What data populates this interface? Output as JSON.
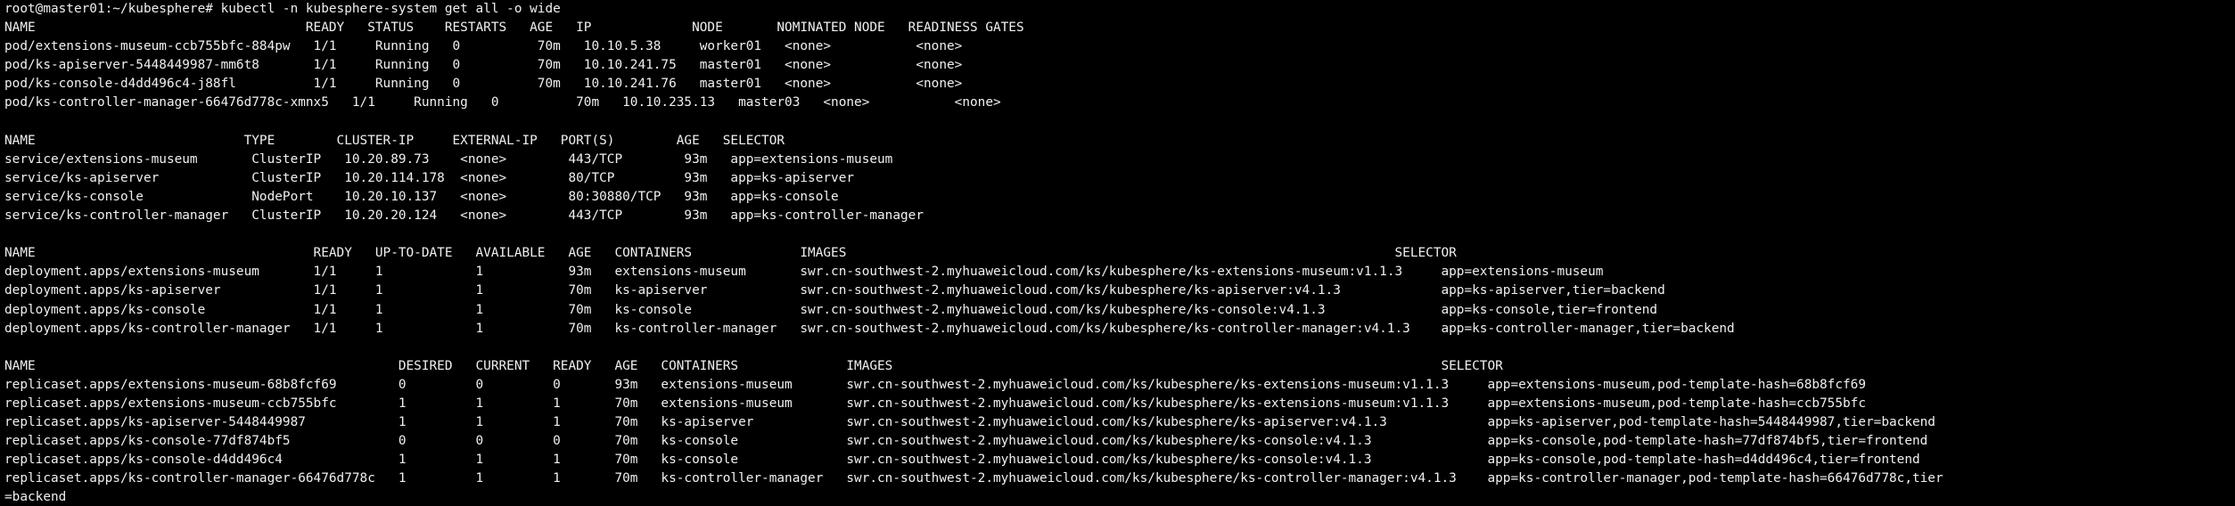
{
  "terminal": {
    "background": "#000000",
    "foreground": "#f0f0f0",
    "lines": [
      "root@master01:~/kubesphere# kubectl -n kubesphere-system get all -o wide",
      "NAME                                   READY   STATUS    RESTARTS   AGE   IP             NODE       NOMINATED NODE   READINESS GATES",
      "pod/extensions-museum-ccb755bfc-884pw   1/1     Running   0          70m   10.10.5.38     worker01   <none>           <none>",
      "pod/ks-apiserver-5448449987-mm6t8       1/1     Running   0          70m   10.10.241.75   master01   <none>           <none>",
      "pod/ks-console-d4dd496c4-j88fl          1/1     Running   0          70m   10.10.241.76   master01   <none>           <none>",
      "pod/ks-controller-manager-66476d778c-xmnx5   1/1     Running   0          70m   10.10.235.13   master03   <none>           <none>",
      "",
      "NAME                           TYPE        CLUSTER-IP     EXTERNAL-IP   PORT(S)        AGE   SELECTOR",
      "service/extensions-museum       ClusterIP   10.20.89.73    <none>        443/TCP        93m   app=extensions-museum",
      "service/ks-apiserver            ClusterIP   10.20.114.178  <none>        80/TCP         93m   app=ks-apiserver",
      "service/ks-console              NodePort    10.20.10.137   <none>        80:30880/TCP   93m   app=ks-console",
      "service/ks-controller-manager   ClusterIP   10.20.20.124   <none>        443/TCP        93m   app=ks-controller-manager",
      "",
      "NAME                                    READY   UP-TO-DATE   AVAILABLE   AGE   CONTAINERS              IMAGES                                                                       SELECTOR",
      "deployment.apps/extensions-museum       1/1     1            1           93m   extensions-museum       swr.cn-southwest-2.myhuaweicloud.com/ks/kubesphere/ks-extensions-museum:v1.1.3     app=extensions-museum",
      "deployment.apps/ks-apiserver            1/1     1            1           70m   ks-apiserver            swr.cn-southwest-2.myhuaweicloud.com/ks/kubesphere/ks-apiserver:v4.1.3             app=ks-apiserver,tier=backend",
      "deployment.apps/ks-console              1/1     1            1           70m   ks-console              swr.cn-southwest-2.myhuaweicloud.com/ks/kubesphere/ks-console:v4.1.3               app=ks-console,tier=frontend",
      "deployment.apps/ks-controller-manager   1/1     1            1           70m   ks-controller-manager   swr.cn-southwest-2.myhuaweicloud.com/ks/kubesphere/ks-controller-manager:v4.1.3    app=ks-controller-manager,tier=backend",
      "",
      "NAME                                               DESIRED   CURRENT   READY   AGE   CONTAINERS              IMAGES                                                                       SELECTOR",
      "replicaset.apps/extensions-museum-68b8fcf69        0         0         0       93m   extensions-museum       swr.cn-southwest-2.myhuaweicloud.com/ks/kubesphere/ks-extensions-museum:v1.1.3     app=extensions-museum,pod-template-hash=68b8fcf69",
      "replicaset.apps/extensions-museum-ccb755bfc        1         1         1       70m   extensions-museum       swr.cn-southwest-2.myhuaweicloud.com/ks/kubesphere/ks-extensions-museum:v1.1.3     app=extensions-museum,pod-template-hash=ccb755bfc",
      "replicaset.apps/ks-apiserver-5448449987            1         1         1       70m   ks-apiserver            swr.cn-southwest-2.myhuaweicloud.com/ks/kubesphere/ks-apiserver:v4.1.3             app=ks-apiserver,pod-template-hash=5448449987,tier=backend",
      "replicaset.apps/ks-console-77df874bf5              0         0         0       70m   ks-console              swr.cn-southwest-2.myhuaweicloud.com/ks/kubesphere/ks-console:v4.1.3               app=ks-console,pod-template-hash=77df874bf5,tier=frontend",
      "replicaset.apps/ks-console-d4dd496c4               1         1         1       70m   ks-console              swr.cn-southwest-2.myhuaweicloud.com/ks/kubesphere/ks-console:v4.1.3               app=ks-console,pod-template-hash=d4dd496c4,tier=frontend",
      "replicaset.apps/ks-controller-manager-66476d778c   1         1         1       70m   ks-controller-manager   swr.cn-southwest-2.myhuaweicloud.com/ks/kubesphere/ks-controller-manager:v4.1.3    app=ks-controller-manager,pod-template-hash=66476d778c,tier",
      "=backend"
    ]
  }
}
